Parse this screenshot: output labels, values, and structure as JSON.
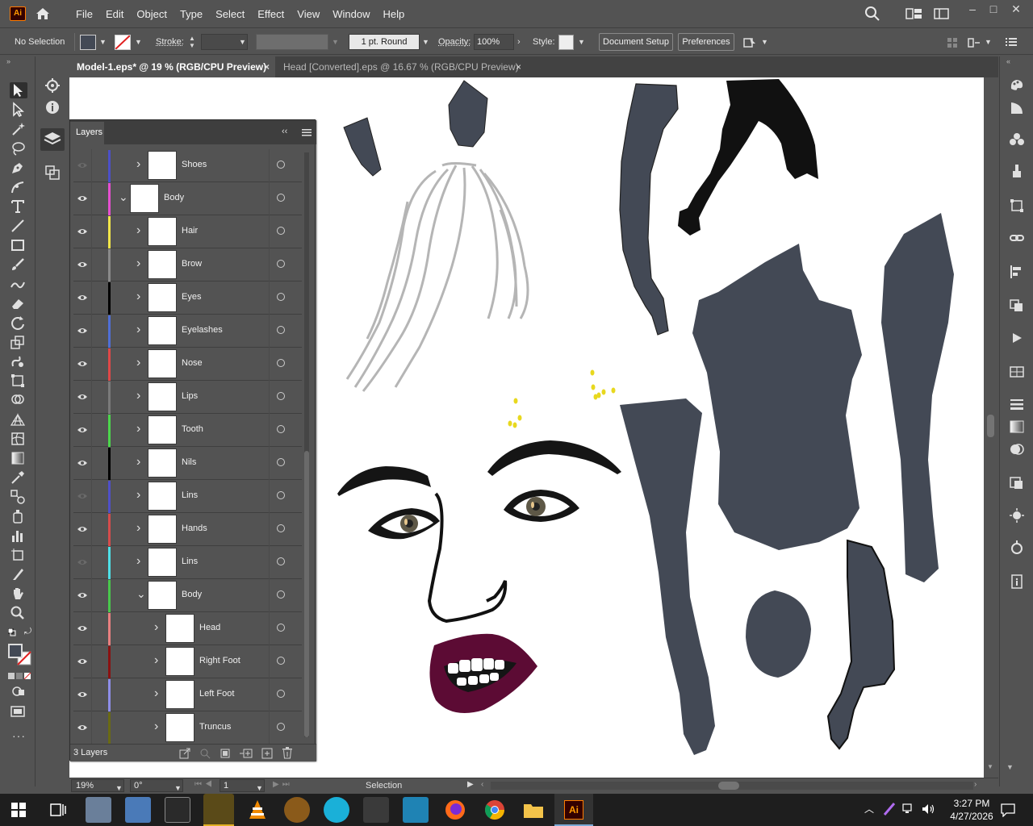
{
  "app": {
    "logo": "Ai"
  },
  "menu": [
    "File",
    "Edit",
    "Object",
    "Type",
    "Select",
    "Effect",
    "View",
    "Window",
    "Help"
  ],
  "control": {
    "selection": "No Selection",
    "stroke_label": "Stroke:",
    "brush": "1 pt. Round",
    "opacity_label": "Opacity:",
    "opacity_value": "100%",
    "style_label": "Style:",
    "doc_setup": "Document Setup",
    "preferences": "Preferences"
  },
  "tabs": [
    {
      "label": "Model-1.eps* @ 19 % (RGB/CPU Preview)",
      "close": "×",
      "active": true
    },
    {
      "label": "Head [Converted].eps @ 16.67 % (RGB/CPU Preview)",
      "close": "×",
      "active": false
    }
  ],
  "layers_panel": {
    "title": "Layers",
    "footer_count": "3 Layers",
    "rows": [
      {
        "name": "Shoes",
        "visible": false,
        "color": "#4c50c8",
        "indent": 1,
        "expanded": false
      },
      {
        "name": "Body",
        "visible": true,
        "color": "#e64fd0",
        "indent": 0,
        "expanded": true
      },
      {
        "name": "Hair",
        "visible": true,
        "color": "#f2e64a",
        "indent": 1,
        "expanded": false
      },
      {
        "name": "Brow",
        "visible": true,
        "color": "#8a8a8a",
        "indent": 1,
        "expanded": false
      },
      {
        "name": "Eyes",
        "visible": true,
        "color": "#000000",
        "indent": 1,
        "expanded": false
      },
      {
        "name": "Eyelashes",
        "visible": true,
        "color": "#4f6fd6",
        "indent": 1,
        "expanded": false
      },
      {
        "name": "Nose",
        "visible": true,
        "color": "#e04848",
        "indent": 1,
        "expanded": false
      },
      {
        "name": "Lips",
        "visible": true,
        "color": "#7a7a7a",
        "indent": 1,
        "expanded": false
      },
      {
        "name": "Tooth",
        "visible": true,
        "color": "#4cd64c",
        "indent": 1,
        "expanded": false
      },
      {
        "name": "Nils",
        "visible": true,
        "color": "#000000",
        "indent": 1,
        "expanded": false
      },
      {
        "name": "Lins",
        "visible": false,
        "color": "#4f50c8",
        "indent": 1,
        "expanded": false
      },
      {
        "name": "Hands",
        "visible": true,
        "color": "#d64c4c",
        "indent": 1,
        "expanded": false
      },
      {
        "name": "Lins",
        "visible": false,
        "color": "#4ee0e8",
        "indent": 1,
        "expanded": false
      },
      {
        "name": "Body",
        "visible": true,
        "color": "#49c84c",
        "indent": 1,
        "expanded": true
      },
      {
        "name": "Head",
        "visible": true,
        "color": "#e88080",
        "indent": 2,
        "expanded": false
      },
      {
        "name": "Right Foot",
        "visible": true,
        "color": "#8a1212",
        "indent": 2,
        "expanded": false
      },
      {
        "name": "Left Foot",
        "visible": true,
        "color": "#8e8ee8",
        "indent": 2,
        "expanded": false
      },
      {
        "name": "Truncus",
        "visible": true,
        "color": "#6a6a14",
        "indent": 2,
        "expanded": false
      }
    ]
  },
  "status": {
    "zoom": "19%",
    "rotation": "0°",
    "artboard": "1",
    "tool": "Selection"
  },
  "taskbar": {
    "time": "3:27 PM",
    "date": "4/27/2026"
  },
  "colors": {
    "skin": "#434955",
    "lips": "#5c0b34",
    "hair_gray": "#b9b9b9"
  }
}
